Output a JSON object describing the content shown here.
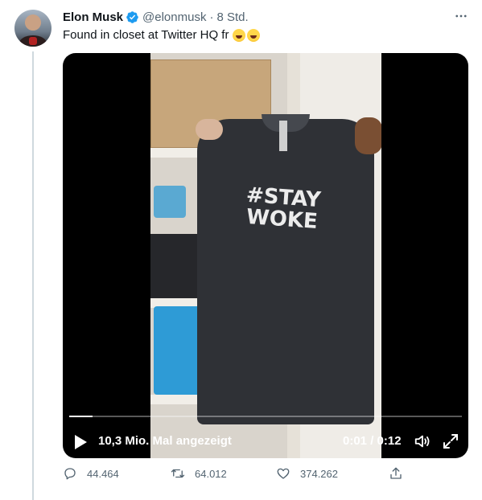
{
  "tweet": {
    "author_name": "Elon Musk",
    "handle": "@elonmusk",
    "separator": "·",
    "time": "8 Std.",
    "text": "Found in closet at Twitter HQ fr",
    "emojis": [
      "rolling-on-floor-laughing-emoji",
      "rolling-on-floor-laughing-emoji"
    ],
    "more_icon": "more-horizontal-icon",
    "verified_icon": "verified-badge-icon",
    "verified_color": "#1d9bf0"
  },
  "video": {
    "shirt_print_line1": "#STAY",
    "shirt_print_line2": "WOKE",
    "views_label": "10,3 Mio. Mal angezeigt",
    "current_time": "0:01",
    "time_separator": "/",
    "duration": "0:12",
    "progress_fraction": 0.06,
    "play_icon": "play-icon",
    "volume_icon": "volume-icon",
    "fullscreen_icon": "fullscreen-icon"
  },
  "actions": {
    "reply": {
      "icon": "reply-icon",
      "count": "44.464"
    },
    "retweet": {
      "icon": "retweet-icon",
      "count": "64.012"
    },
    "like": {
      "icon": "heart-icon",
      "count": "374.262"
    },
    "share": {
      "icon": "share-icon"
    }
  },
  "colors": {
    "secondary_text": "#536471",
    "thread_line": "#cfd9de"
  }
}
